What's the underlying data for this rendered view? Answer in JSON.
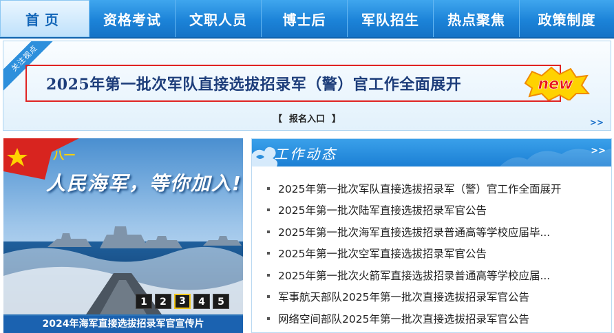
{
  "nav": {
    "items": [
      "首页",
      "资格考试",
      "文职人员",
      "博士后",
      "军队招生",
      "热点聚焦",
      "政策制度"
    ]
  },
  "banner": {
    "ribbon": "关注视点",
    "headline": "2025年第一批次军队直接选拔招录军（警）官工作全面展开",
    "new_badge": "new",
    "signup_left": "【",
    "signup_label": "报名入口",
    "signup_right": "】",
    "more": ">>"
  },
  "slider": {
    "slogan": "人民海军，等你加入!",
    "flag_text": "八一",
    "pages": [
      "1",
      "2",
      "3",
      "4",
      "5"
    ],
    "active_page": "3",
    "caption": "2024年海军直接选拔招录军官宣传片"
  },
  "news": {
    "title": "工作动态",
    "more": ">>",
    "items": [
      "2025年第一批次军队直接选拔招录军（警）官工作全面展开",
      "2025年第一批次陆军直接选拔招录军官公告",
      "2025年第一批次海军直接选拔招录普通高等学校应届毕...",
      "2025年第一批次空军直接选拔招录军官公告",
      "2025年第一批次火箭军直接选拔招录普通高等学校应届...",
      "军事航天部队2025年第一批次直接选拔招录军官公告",
      "网络空间部队2025年第一批次直接选拔招录军官公告"
    ]
  },
  "colors": {
    "nav_blue": "#1c83d8",
    "highlight_red": "#e02222",
    "headline_navy": "#1d3d7a",
    "new_yellow": "#ffd200"
  }
}
